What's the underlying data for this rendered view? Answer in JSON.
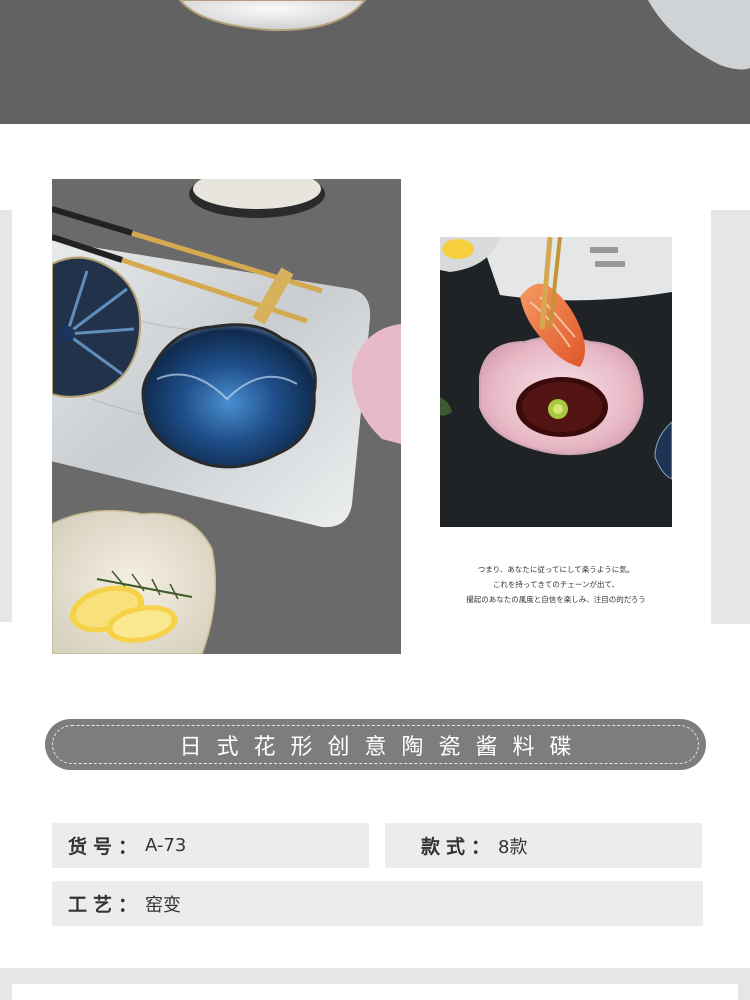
{
  "caption": {
    "lines": [
      "つまり、あなたに従ってにして楽うように気。",
      "これを持ってきてのチェーンが出て、",
      "撮起のあなたの風度と自信を楽しみ、注目の的だろう"
    ]
  },
  "title": {
    "text": "日式花形创意陶瓷酱料碟"
  },
  "specs": {
    "item_no": {
      "label": "货号：",
      "value": "A-73"
    },
    "style": {
      "label": "款式：",
      "value": "8款"
    },
    "craft": {
      "label": "工艺：",
      "value": "窑变"
    }
  },
  "colors": {
    "banner_bg": "#7d7d7d",
    "spec_bg": "#ececec",
    "side_bars": "#e6e6e6",
    "blue_glaze": "#1f4f8a",
    "pink_glaze": "#e8b9c6"
  }
}
